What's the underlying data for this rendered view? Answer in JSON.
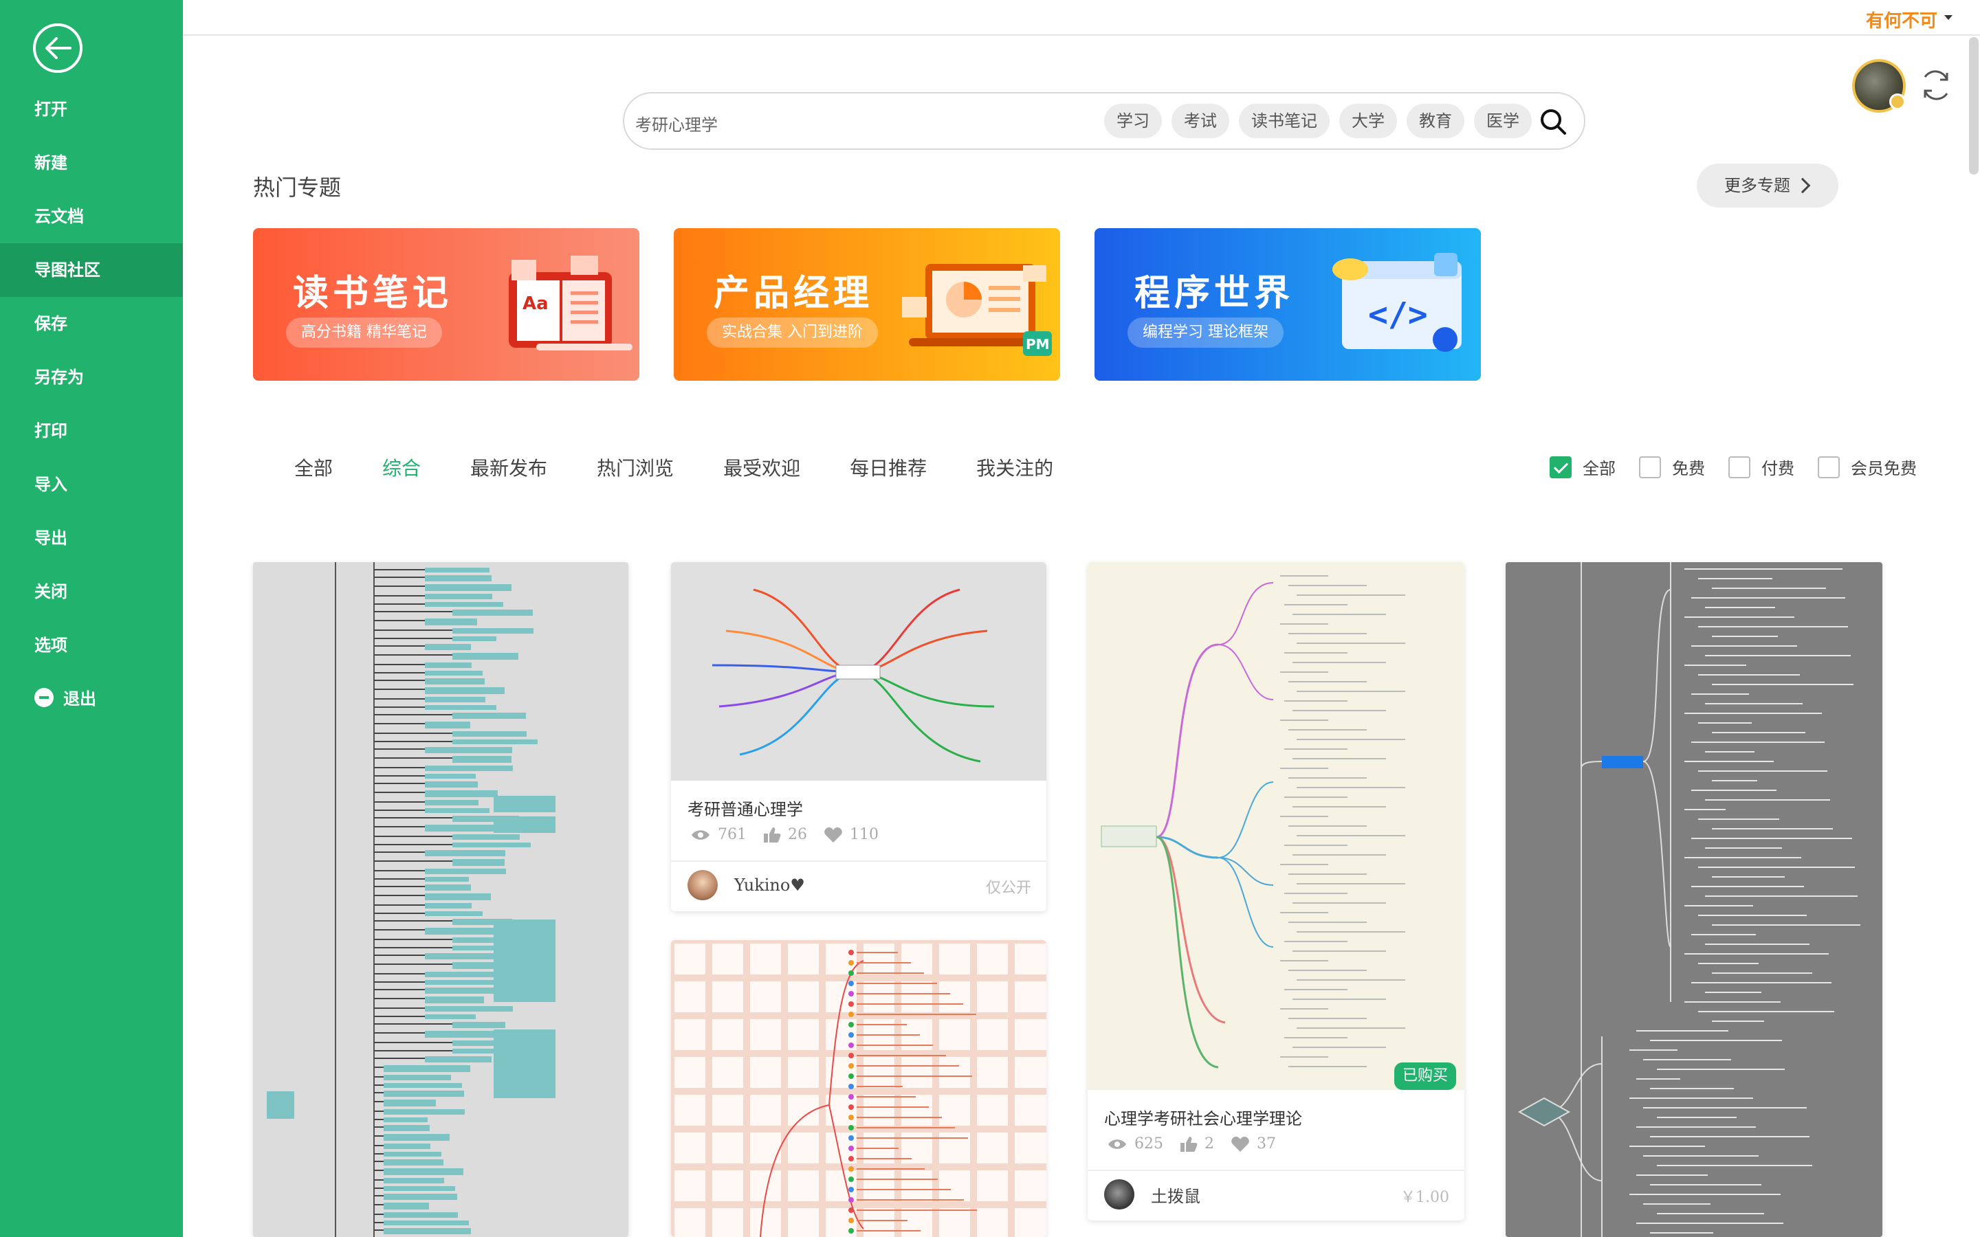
{
  "sidebar": {
    "items": [
      {
        "label": "打开"
      },
      {
        "label": "新建"
      },
      {
        "label": "云文档"
      },
      {
        "label": "导图社区"
      },
      {
        "label": "保存"
      },
      {
        "label": "另存为"
      },
      {
        "label": "打印"
      },
      {
        "label": "导入"
      },
      {
        "label": "导出"
      },
      {
        "label": "关闭"
      },
      {
        "label": "选项"
      },
      {
        "label": "退出"
      }
    ],
    "active_item": "导图社区",
    "back_icon": "arrow-left-circle-icon",
    "exit_icon": "minus-circle-icon"
  },
  "header": {
    "user_name": "有何不可"
  },
  "search": {
    "value": "考研心理学",
    "tags": [
      "学习",
      "考试",
      "读书笔记",
      "大学",
      "教育",
      "医学"
    ]
  },
  "topics": {
    "title": "热门专题",
    "more_label": "更多专题",
    "banners": [
      {
        "title": "读书笔记",
        "subtitle": "高分书籍 精华笔记",
        "badge": "Aa"
      },
      {
        "title": "产品经理",
        "subtitle": "实战合集 入门到进阶",
        "badge": "PM"
      },
      {
        "title": "程序世界",
        "subtitle": "编程学习 理论框架",
        "badge": "</>"
      }
    ]
  },
  "tabs": [
    "全部",
    "综合",
    "最新发布",
    "热门浏览",
    "最受欢迎",
    "每日推荐",
    "我关注的"
  ],
  "active_tab": "综合",
  "filters": [
    {
      "label": "全部",
      "checked": true
    },
    {
      "label": "免费",
      "checked": false
    },
    {
      "label": "付费",
      "checked": false
    },
    {
      "label": "会员免费",
      "checked": false
    }
  ],
  "cards": [
    {
      "title": "考研普通心理学",
      "views": "761",
      "likes": "26",
      "favorites": "110",
      "author": "Yukino♥",
      "price": "仅公开"
    },
    {
      "title": "心理学考研社会心理学理论",
      "views": "625",
      "likes": "2",
      "favorites": "37",
      "author": "土拨鼠",
      "price": "￥1.00",
      "badge": "已购买"
    }
  ],
  "colors": {
    "accent": "#21b26e",
    "user_name": "#f08a1c"
  }
}
